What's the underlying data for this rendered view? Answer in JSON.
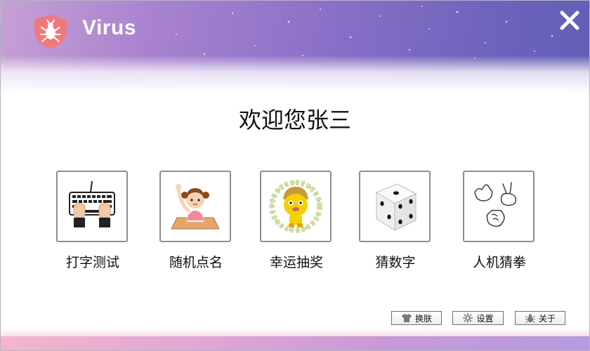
{
  "window": {
    "title": "Virus",
    "close_icon": "close-icon",
    "logo_icon": "shield-bug-icon"
  },
  "welcome": {
    "text": "欢迎您张三"
  },
  "features": [
    {
      "label": "打字测试",
      "icon": "keyboard-hands-icon"
    },
    {
      "label": "随机点名",
      "icon": "girl-raising-hand-icon"
    },
    {
      "label": "幸运抽奖",
      "icon": "lucky-mascot-icon"
    },
    {
      "label": "猜数字",
      "icon": "dice-icon"
    },
    {
      "label": "人机猜拳",
      "icon": "rock-paper-scissors-icon"
    }
  ],
  "footer_buttons": {
    "skin": {
      "label": "换肤",
      "icon": "tshirt-icon"
    },
    "settings": {
      "label": "设置",
      "icon": "gear-icon"
    },
    "about": {
      "label": "关于",
      "icon": "bug-icon"
    }
  },
  "colors": {
    "banner_left": "#c6a0d4",
    "banner_right": "#5f5fb5",
    "logo_red": "#f0787a",
    "footer_pink": "#f4b6c8"
  }
}
